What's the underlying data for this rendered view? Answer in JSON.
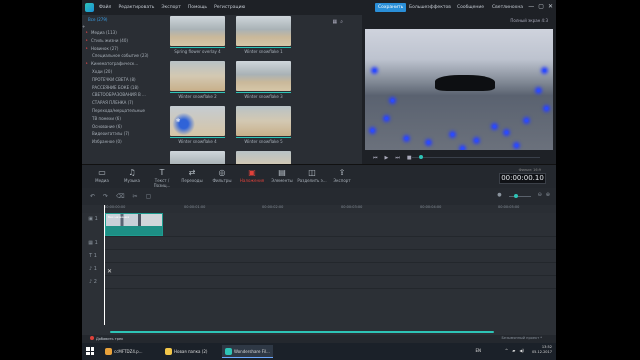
{
  "menu": {
    "items": [
      "Файл",
      "Редактировать",
      "Экспорт",
      "Помощь",
      "Регистрацию"
    ],
    "right_buttons": [
      "Сохранить",
      "Большеэффектов",
      "Сообщение",
      "Светлинохна"
    ],
    "window_controls": [
      "—",
      "▢",
      "✕"
    ]
  },
  "library": {
    "top": "Все (279)",
    "add_icon": "plus-icon",
    "items": [
      {
        "label": "Медиа (113)",
        "sub": false
      },
      {
        "label": "Стиль жизни (40)",
        "sub": false
      },
      {
        "label": "Новинок (27)",
        "sub": false
      },
      {
        "label": "Специальное событие (23)",
        "sub": true
      },
      {
        "label": "Кинематографическ...",
        "sub": false
      },
      {
        "label": "Ходи (20)",
        "sub": true
      },
      {
        "label": "ПРОТЕЧКИ СВЕТА (8)",
        "sub": true
      },
      {
        "label": "РАССЕЯНИЕ БОКЕ (18)",
        "sub": true
      },
      {
        "label": "СВЕТООБРАЗОВАНИЯ В ...",
        "sub": true
      },
      {
        "label": "СТАРАЯ ПЛЕНКА (7)",
        "sub": true
      },
      {
        "label": "Перехода/мерцательные",
        "sub": true
      },
      {
        "label": "ТВ помехи (6)",
        "sub": true
      },
      {
        "label": "Основание (6)",
        "sub": true
      },
      {
        "label": "Видеоигатэлы (7)",
        "sub": true
      },
      {
        "label": "Избранное (0)",
        "sub": true
      }
    ]
  },
  "thumbnails": [
    {
      "label": "Spring flower overlay 4",
      "style": "road"
    },
    {
      "label": "Winter snowflake 1",
      "style": "road"
    },
    {
      "label": "Winter snowflake 2",
      "style": "road2"
    },
    {
      "label": "Winter snowflake 3",
      "style": "road"
    },
    {
      "label": "Winter snowflake 4",
      "style": "blue"
    },
    {
      "label": "Winter snowflake 5",
      "style": "road2"
    },
    {
      "label": "",
      "style": "road"
    },
    {
      "label": "",
      "style": "road2"
    }
  ],
  "grid_tools": [
    "grid-icon",
    "search-icon"
  ],
  "preview": {
    "top_text": "Полный экран  4:3",
    "controls": [
      "⏮",
      "▶",
      "⏭",
      "■"
    ]
  },
  "toolbar": {
    "tools": [
      {
        "label": "Медиа",
        "icon": "▭"
      },
      {
        "label": "Музыка",
        "icon": "♫"
      },
      {
        "label": "Текст /Позиц...",
        "icon": "T"
      },
      {
        "label": "Переходы",
        "icon": "⇄"
      },
      {
        "label": "Фильтры",
        "icon": "◎"
      },
      {
        "label": "Наложения",
        "icon": "▣",
        "active": true
      },
      {
        "label": "Элементы",
        "icon": "▤"
      },
      {
        "label": "Разделить э...",
        "icon": "◫"
      },
      {
        "label": "Экспорт",
        "icon": "⇪"
      }
    ],
    "time_label": "Фильм: 16:9",
    "time": "00:00:00.10"
  },
  "timeline": {
    "tools_left": [
      "↶",
      "↷",
      "⌫",
      "✂",
      "▢"
    ],
    "tools_right": [
      "●",
      "⊖",
      "⊕"
    ],
    "ruler": [
      "00:00:00:00",
      "00:00:01:00",
      "00:00:02:00",
      "00:00:03:00",
      "00:00:04:00",
      "00:00:05:00"
    ],
    "tracks": [
      {
        "label": "▣ 1",
        "height": 24
      },
      {
        "label": "▦ 1",
        "height": 13
      },
      {
        "label": "T 1",
        "height": 13
      },
      {
        "label": "♪ 1",
        "height": 13
      },
      {
        "label": "♪ 2",
        "height": 13
      }
    ],
    "clip_label": "Без названия",
    "x_mark": "✕"
  },
  "status": {
    "left": "Добавить трек",
    "right": "Безымянный проект *"
  },
  "taskbar": {
    "items": [
      {
        "label": "",
        "color": "#ffcc33"
      },
      {
        "label": "ccMFTDZ4.p...",
        "color": "#e9a23b"
      },
      {
        "label": "Новая папка (2)",
        "color": "#f2c64a"
      },
      {
        "label": "Wondershare Fil...",
        "color": "#2ec4b6"
      }
    ],
    "lang": "EN",
    "time": "13:52",
    "date": "05.12.2017"
  }
}
